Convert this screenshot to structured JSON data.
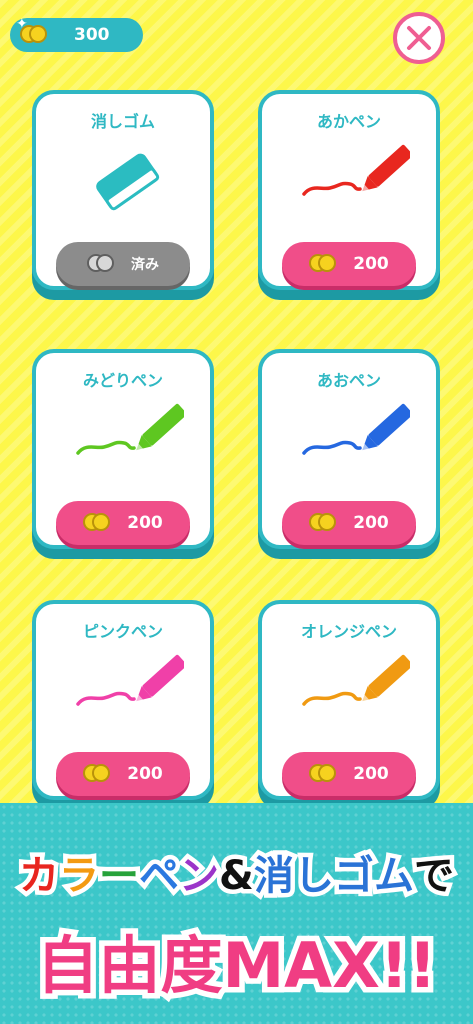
{
  "header": {
    "coins": "300",
    "close_icon": "close-x-icon"
  },
  "colors": {
    "teal": "#2fb8c3",
    "pink": "#f04e89",
    "yellow": "#fdf74a",
    "owned": "#8c8c8c"
  },
  "items": [
    {
      "name": "消しゴム",
      "button": "済み",
      "state": "owned",
      "icon": "eraser-icon",
      "color": "#2bbcc1"
    },
    {
      "name": "あかペン",
      "button": "200",
      "state": "buy",
      "icon": "pen-icon",
      "color": "#e8271f"
    },
    {
      "name": "みどりペン",
      "button": "200",
      "state": "buy",
      "icon": "pen-icon",
      "color": "#5ec721"
    },
    {
      "name": "あおペン",
      "button": "200",
      "state": "buy",
      "icon": "pen-icon",
      "color": "#2568e0"
    },
    {
      "name": "ピンクペン",
      "button": "200",
      "state": "buy",
      "icon": "pen-icon",
      "color": "#f040a8"
    },
    {
      "name": "オレンジペン",
      "button": "200",
      "state": "buy",
      "icon": "pen-icon",
      "color": "#f09a12"
    }
  ],
  "banner": {
    "line1": [
      {
        "text": "カ",
        "color": "#e8251f"
      },
      {
        "text": "ラ",
        "color": "#f39a12"
      },
      {
        "text": "ー",
        "color": "#27a23a"
      },
      {
        "text": "ペ",
        "color": "#2b78e0"
      },
      {
        "text": "ン",
        "color": "#9b35c9"
      },
      {
        "text": "&",
        "color": "#111111"
      },
      {
        "text": "消",
        "color": "#2a73d6"
      },
      {
        "text": "し",
        "color": "#2a73d6"
      },
      {
        "text": "ゴ",
        "color": "#2a73d6"
      },
      {
        "text": "ム",
        "color": "#2a73d6"
      },
      {
        "text": "で",
        "color": "#111111"
      }
    ],
    "line2": "自由度MAX!!"
  }
}
